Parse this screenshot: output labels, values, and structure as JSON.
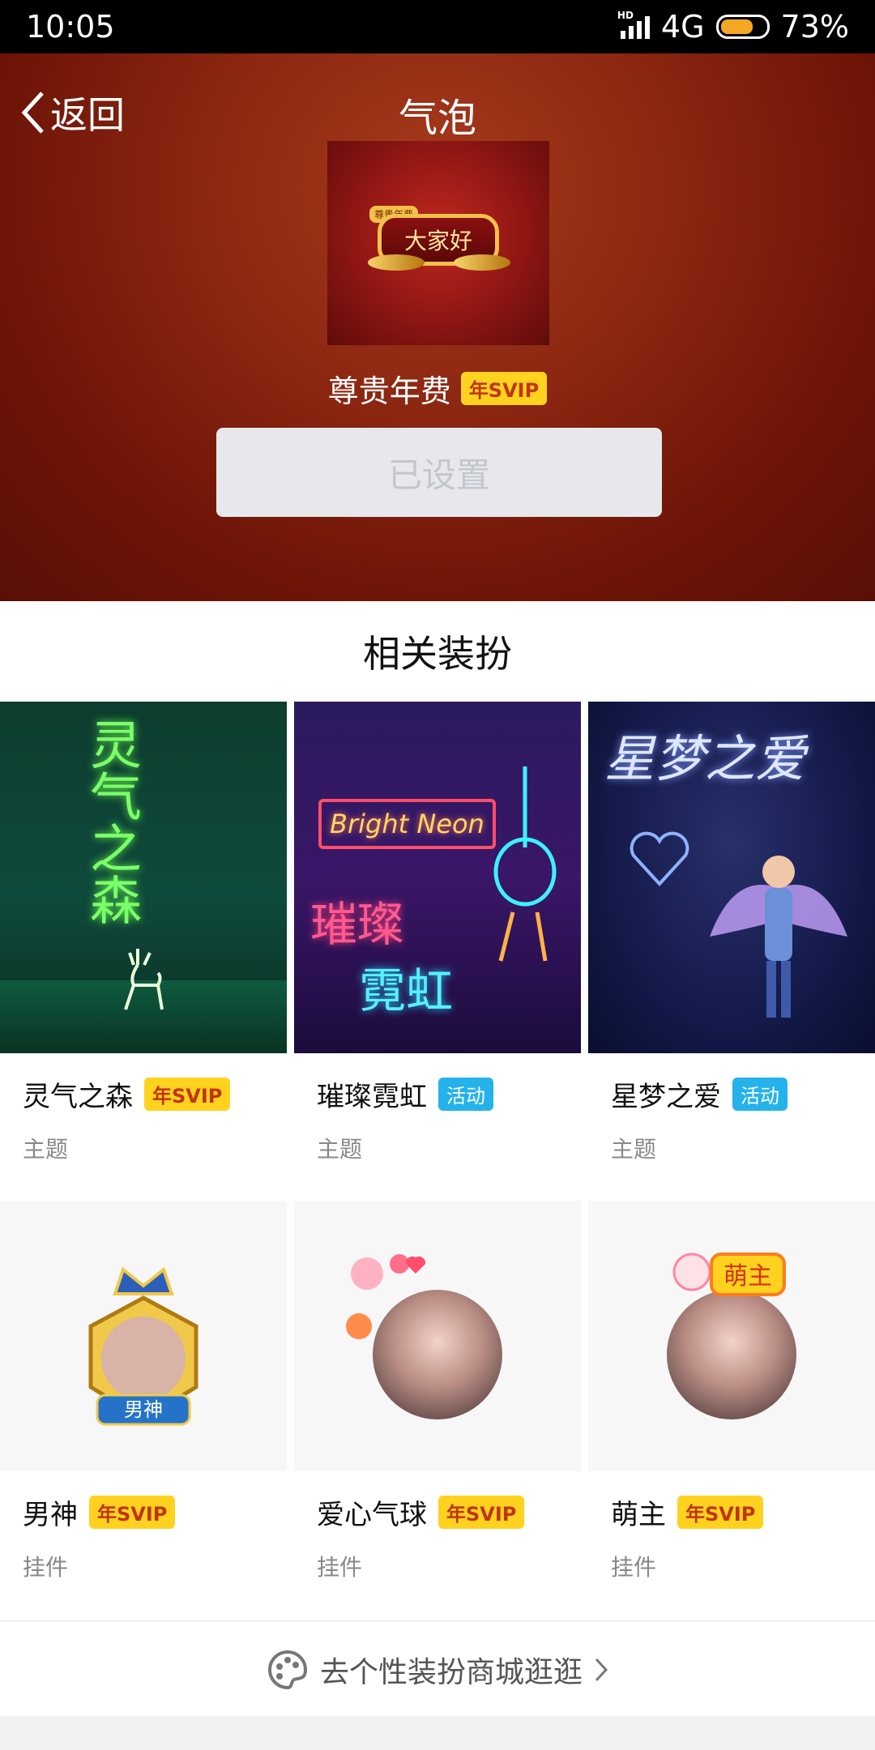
{
  "status_bar": {
    "time": "10:05",
    "network": "4G",
    "battery": "73%",
    "battery_level": 0.73
  },
  "header": {
    "back_label": "返回",
    "title": "气泡"
  },
  "preview": {
    "bubble_text": "大家好",
    "bubble_tag": "尊贵年费",
    "name": "尊贵年费",
    "badge": "年SVIP",
    "set_button": "已设置"
  },
  "related": {
    "title": "相关装扮",
    "items": [
      {
        "thumb_text": "灵气之森",
        "name": "灵气之森",
        "badge": "年SVIP",
        "badge_type": "svip",
        "category": "主题"
      },
      {
        "thumb_text_a": "Bright Neon",
        "thumb_text_b": "璀璨",
        "thumb_text_c": "霓虹",
        "name": "璀璨霓虹",
        "badge": "活动",
        "badge_type": "event",
        "category": "主题"
      },
      {
        "thumb_text": "星梦之爱",
        "name": "星梦之爱",
        "badge": "活动",
        "badge_type": "event",
        "category": "主题"
      },
      {
        "thumb_text": "男神",
        "name": "男神",
        "badge": "年SVIP",
        "badge_type": "svip",
        "category": "挂件"
      },
      {
        "name": "爱心气球",
        "badge": "年SVIP",
        "badge_type": "svip",
        "category": "挂件"
      },
      {
        "thumb_text": "萌主",
        "name": "萌主",
        "badge": "年SVIP",
        "badge_type": "svip",
        "category": "挂件"
      }
    ]
  },
  "footer": {
    "link_text": "去个性装扮商城逛逛"
  },
  "colors": {
    "svip_badge": "#ffd21f",
    "event_badge": "#25b2ea",
    "hero_bg": "#8e2812"
  }
}
